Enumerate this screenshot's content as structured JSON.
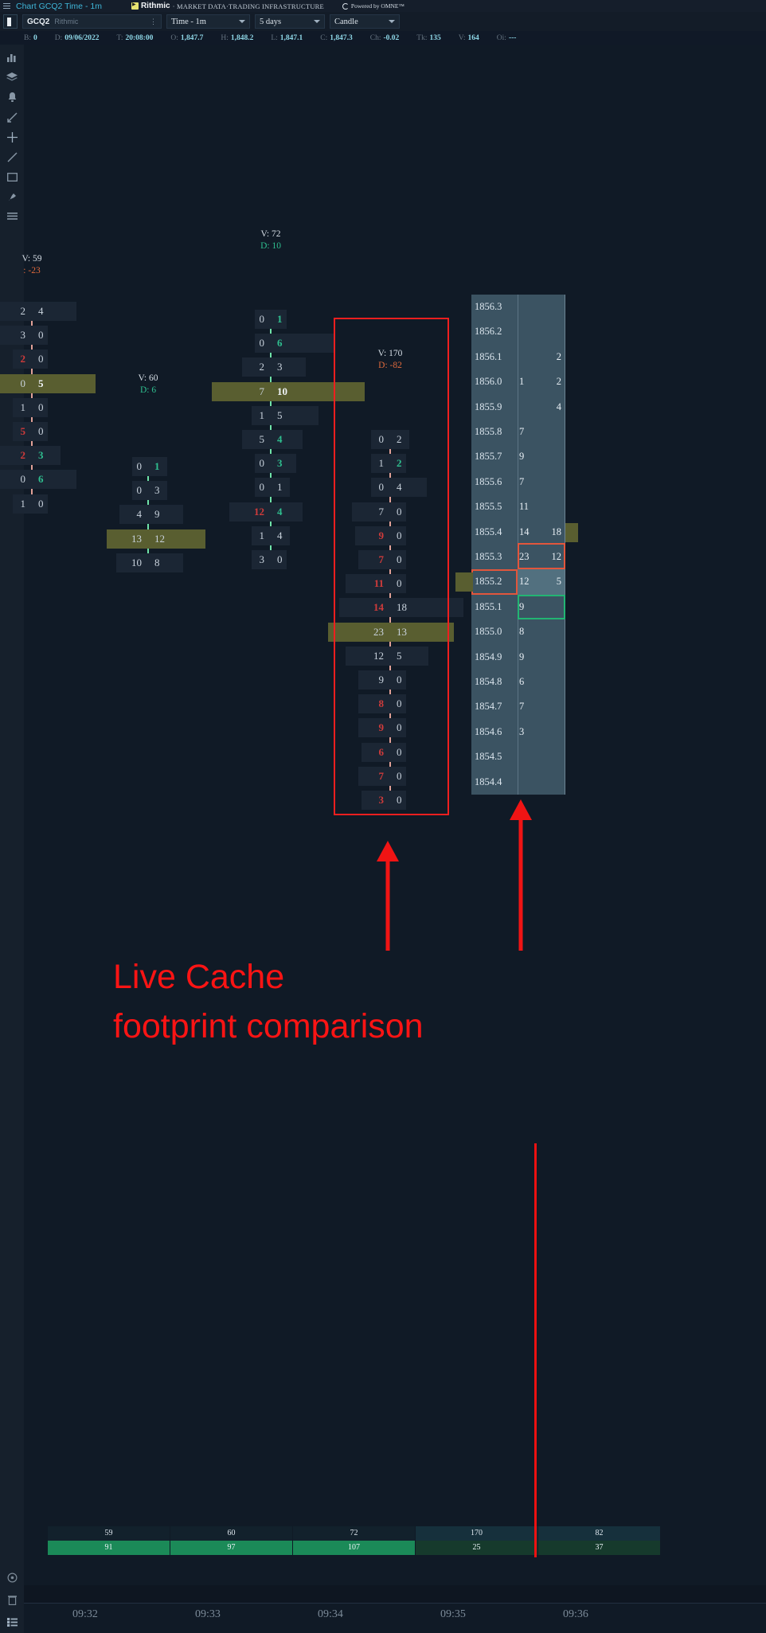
{
  "titlebar": {
    "menu_icon": "hamburger-icon",
    "title": "Chart GCQ2 Time - 1m",
    "rithmic_name": "Rithmic",
    "rithmic_tagline": "· MARKET DATA·TRADING INFRASTRUCTURE",
    "omne_text": "Powered by OMNE™"
  },
  "toolbar": {
    "layout_icon": "panel-toggle-icon",
    "symbol": "GCQ2",
    "symbol_source": "Rithmic",
    "symbol_menu_icon": "kebab-menu-icon",
    "interval": "Time - 1m",
    "range": "5 days",
    "chart_type": "Candle",
    "chevron_icon": "chevron-down-icon"
  },
  "ohlc": [
    {
      "key": "B:",
      "value": "0"
    },
    {
      "key": "D:",
      "value": "09/06/2022"
    },
    {
      "key": "T:",
      "value": "20:08:00"
    },
    {
      "key": "O:",
      "value": "1,847.7"
    },
    {
      "key": "H:",
      "value": "1,848.2"
    },
    {
      "key": "L:",
      "value": "1,847.1"
    },
    {
      "key": "C:",
      "value": "1,847.3"
    },
    {
      "key": "Ch:",
      "value": "-0.02"
    },
    {
      "key": "Tk:",
      "value": "135"
    },
    {
      "key": "V:",
      "value": "164"
    },
    {
      "key": "Oi:",
      "value": "---"
    }
  ],
  "rail_icons": [
    "chart-type-icon",
    "layers-icon",
    "alert-bell-icon",
    "measure-icon",
    "crosshair-icon",
    "trendline-icon",
    "rectangle-icon",
    "brush-icon",
    "list-icon"
  ],
  "rail_bottom_icons": [
    "target-icon",
    "trash-icon",
    "datagrid-icon"
  ],
  "annotation": {
    "line1": "Live Cache",
    "line2": "footprint comparison",
    "color": "#fb1414"
  },
  "chart_data": {
    "type": "footprint",
    "title": "GCQ2 Time - 1m footprint chart",
    "price_tick": 0.1,
    "columns": [
      {
        "time": "09:32",
        "volume_label": "V: 59",
        "delta_label": ": -23",
        "delta": -23,
        "volume": 59,
        "direction": "down",
        "cells": [
          {
            "bid": "2",
            "ask": "4",
            "bid_style": "normal",
            "ask_style": "normal",
            "poc": false
          },
          {
            "bid": "3",
            "ask": "0",
            "bid_style": "normal",
            "ask_style": "normal",
            "poc": false
          },
          {
            "bid": "2",
            "ask": "0",
            "bid_style": "hot",
            "ask_style": "normal",
            "poc": false
          },
          {
            "bid": "0",
            "ask": "5",
            "bid_style": "normal",
            "ask_style": "bold",
            "poc": true
          },
          {
            "bid": "1",
            "ask": "0",
            "bid_style": "normal",
            "ask_style": "normal",
            "poc": false
          },
          {
            "bid": "5",
            "ask": "0",
            "bid_style": "hot",
            "ask_style": "normal",
            "poc": false
          },
          {
            "bid": "2",
            "ask": "3",
            "bid_style": "hot",
            "ask_style": "cool",
            "poc": false
          },
          {
            "bid": "0",
            "ask": "6",
            "bid_style": "normal",
            "ask_style": "cool",
            "poc": false
          },
          {
            "bid": "1",
            "ask": "0",
            "bid_style": "normal",
            "ask_style": "normal",
            "poc": false
          }
        ]
      },
      {
        "time": "09:33",
        "volume_label": "V: 60",
        "delta_label": "D: 6",
        "delta": 6,
        "volume": 60,
        "direction": "up",
        "cells": [
          {
            "bid": "0",
            "ask": "1",
            "bid_style": "normal",
            "ask_style": "cool",
            "poc": false
          },
          {
            "bid": "0",
            "ask": "3",
            "bid_style": "normal",
            "ask_style": "normal",
            "poc": false
          },
          {
            "bid": "4",
            "ask": "9",
            "bid_style": "normal",
            "ask_style": "normal",
            "poc": false
          },
          {
            "bid": "13",
            "ask": "12",
            "bid_style": "normal",
            "ask_style": "normal",
            "poc": true
          },
          {
            "bid": "10",
            "ask": "8",
            "bid_style": "normal",
            "ask_style": "normal",
            "poc": false
          }
        ]
      },
      {
        "time": "09:34",
        "volume_label": "V: 72",
        "delta_label": "D: 10",
        "delta": 10,
        "volume": 72,
        "direction": "up",
        "cells": [
          {
            "bid": "0",
            "ask": "1",
            "bid_style": "normal",
            "ask_style": "cool",
            "poc": false
          },
          {
            "bid": "0",
            "ask": "6",
            "bid_style": "normal",
            "ask_style": "cool",
            "poc": false
          },
          {
            "bid": "2",
            "ask": "3",
            "bid_style": "normal",
            "ask_style": "normal",
            "poc": false
          },
          {
            "bid": "7",
            "ask": "10",
            "bid_style": "normal",
            "ask_style": "bold",
            "poc": true
          },
          {
            "bid": "1",
            "ask": "5",
            "bid_style": "normal",
            "ask_style": "normal",
            "poc": false
          },
          {
            "bid": "5",
            "ask": "4",
            "bid_style": "normal",
            "ask_style": "cool",
            "poc": false
          },
          {
            "bid": "0",
            "ask": "3",
            "bid_style": "normal",
            "ask_style": "cool",
            "poc": false
          },
          {
            "bid": "0",
            "ask": "1",
            "bid_style": "normal",
            "ask_style": "normal",
            "poc": false
          },
          {
            "bid": "12",
            "ask": "4",
            "bid_style": "hot",
            "ask_style": "cool",
            "poc": false
          },
          {
            "bid": "1",
            "ask": "4",
            "bid_style": "normal",
            "ask_style": "normal",
            "poc": false
          },
          {
            "bid": "3",
            "ask": "0",
            "bid_style": "normal",
            "ask_style": "normal",
            "poc": false
          }
        ]
      },
      {
        "time": "09:35",
        "volume_label": "V: 170",
        "delta_label": "D: -82",
        "delta": -82,
        "volume": 170,
        "direction": "down",
        "highlighted": true,
        "cells": [
          {
            "bid": "0",
            "ask": "2",
            "bid_style": "normal",
            "ask_style": "normal",
            "poc": false
          },
          {
            "bid": "1",
            "ask": "2",
            "bid_style": "normal",
            "ask_style": "cool",
            "poc": false
          },
          {
            "bid": "0",
            "ask": "4",
            "bid_style": "normal",
            "ask_style": "normal",
            "poc": false
          },
          {
            "bid": "7",
            "ask": "0",
            "bid_style": "normal",
            "ask_style": "normal",
            "poc": false
          },
          {
            "bid": "9",
            "ask": "0",
            "bid_style": "hot",
            "ask_style": "normal",
            "poc": false
          },
          {
            "bid": "7",
            "ask": "0",
            "bid_style": "hot",
            "ask_style": "normal",
            "poc": false
          },
          {
            "bid": "11",
            "ask": "0",
            "bid_style": "hot",
            "ask_style": "normal",
            "poc": false
          },
          {
            "bid": "14",
            "ask": "18",
            "bid_style": "hot",
            "ask_style": "normal",
            "poc": false
          },
          {
            "bid": "23",
            "ask": "13",
            "bid_style": "normal",
            "ask_style": "normal",
            "poc": true
          },
          {
            "bid": "12",
            "ask": "5",
            "bid_style": "normal",
            "ask_style": "normal",
            "poc": false
          },
          {
            "bid": "9",
            "ask": "0",
            "bid_style": "normal",
            "ask_style": "normal",
            "poc": false
          },
          {
            "bid": "8",
            "ask": "0",
            "bid_style": "hot",
            "ask_style": "normal",
            "poc": false
          },
          {
            "bid": "9",
            "ask": "0",
            "bid_style": "hot",
            "ask_style": "normal",
            "poc": false
          },
          {
            "bid": "6",
            "ask": "0",
            "bid_style": "hot",
            "ask_style": "normal",
            "poc": false
          },
          {
            "bid": "7",
            "ask": "0",
            "bid_style": "hot",
            "ask_style": "normal",
            "poc": false
          },
          {
            "bid": "3",
            "ask": "0",
            "bid_style": "hot",
            "ask_style": "normal",
            "poc": false
          }
        ]
      },
      {
        "time": "09:36",
        "volume_label": "",
        "delta_label": "",
        "volume": 82,
        "delta": 37,
        "direction": "up",
        "cells": []
      }
    ],
    "volume_row": [
      "59",
      "60",
      "72",
      "170",
      "82"
    ],
    "delta_row": [
      "91",
      "97",
      "107",
      "25",
      "37"
    ],
    "time_labels": [
      "09:32",
      "09:33",
      "09:34",
      "09:35",
      "09:36"
    ]
  },
  "dom_ladder": {
    "rows": [
      {
        "price": "1856.3",
        "bid": "",
        "ask": ""
      },
      {
        "price": "1856.2",
        "bid": "",
        "ask": ""
      },
      {
        "price": "1856.1",
        "bid": "",
        "ask": "2"
      },
      {
        "price": "1856.0",
        "bid": "1",
        "ask": "2"
      },
      {
        "price": "1855.9",
        "bid": "",
        "ask": "4"
      },
      {
        "price": "1855.8",
        "bid": "7",
        "ask": ""
      },
      {
        "price": "1855.7",
        "bid": "9",
        "ask": ""
      },
      {
        "price": "1855.6",
        "bid": "7",
        "ask": ""
      },
      {
        "price": "1855.5",
        "bid": "11",
        "ask": ""
      },
      {
        "price": "1855.4",
        "bid": "14",
        "ask": "18"
      },
      {
        "price": "1855.3",
        "bid": "23",
        "ask": "12",
        "mark": "red"
      },
      {
        "price": "1855.2",
        "bid": "12",
        "ask": "5",
        "highlight": true,
        "left_mark": "red"
      },
      {
        "price": "1855.1",
        "bid": "9",
        "ask": "",
        "mark": "green"
      },
      {
        "price": "1855.0",
        "bid": "8",
        "ask": ""
      },
      {
        "price": "1854.9",
        "bid": "9",
        "ask": ""
      },
      {
        "price": "1854.8",
        "bid": "6",
        "ask": ""
      },
      {
        "price": "1854.7",
        "bid": "7",
        "ask": ""
      },
      {
        "price": "1854.6",
        "bid": "3",
        "ask": ""
      },
      {
        "price": "1854.5",
        "bid": "",
        "ask": ""
      },
      {
        "price": "1854.4",
        "bid": "",
        "ask": ""
      }
    ]
  }
}
